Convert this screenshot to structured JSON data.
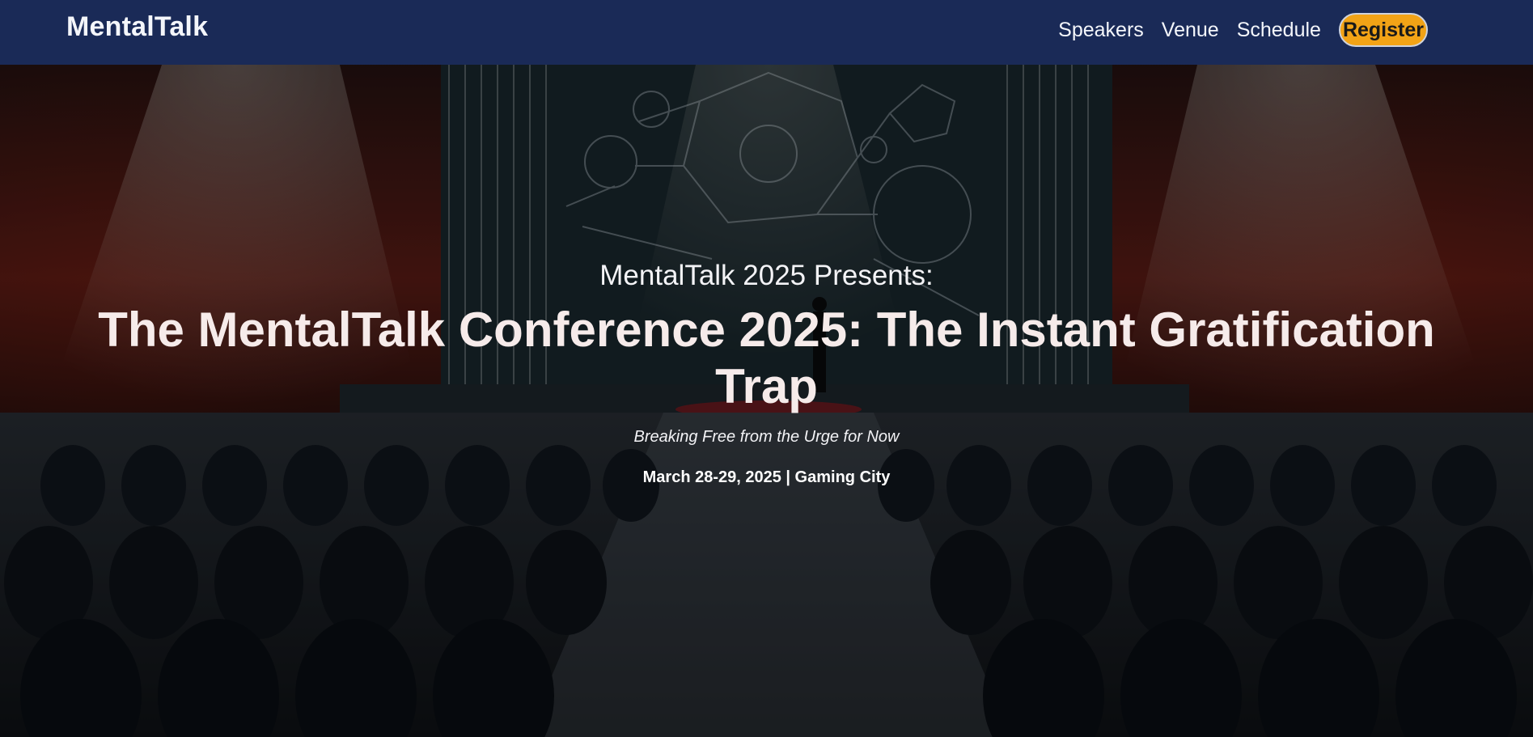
{
  "navbar": {
    "brand": "MentalTalk",
    "links": [
      {
        "label": "Speakers"
      },
      {
        "label": "Venue"
      },
      {
        "label": "Schedule"
      }
    ],
    "register_label": "Register",
    "colors": {
      "background": "#1a2a57",
      "register_button": "#f2a316"
    }
  },
  "hero": {
    "eyebrow": "MentalTalk 2025 Presents:",
    "title": "The MentalTalk Conference 2025: The Instant Gratification Trap",
    "subtitle": "Breaking Free from the Urge for Now",
    "dateline": "March 28-29, 2025 | Gaming City"
  }
}
